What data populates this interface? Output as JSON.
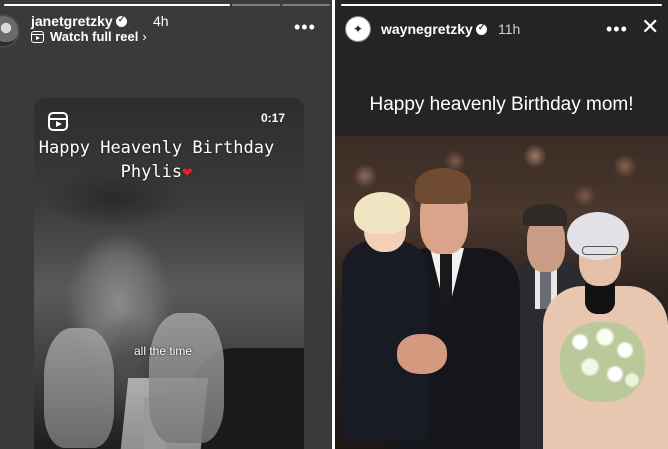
{
  "left_story": {
    "username": "janetgretzky",
    "time": "4h",
    "watch_label": "Watch full reel",
    "more_label": "•••",
    "reel": {
      "duration": "0:17",
      "overlay_line1": "Happy Heavenly Birthday",
      "overlay_line2": "Phylis",
      "heart": "❤",
      "caption": "all the time"
    },
    "progress": [
      1.0,
      0.0,
      0.0
    ]
  },
  "right_story": {
    "username": "waynegretzky",
    "time": "11h",
    "more_label": "•••",
    "close_label": "✕",
    "caption": "Happy heavenly Birthday mom!"
  },
  "colors": {
    "left_background": "#3a3a3c",
    "right_background": "#242424",
    "heart": "#e0242f"
  },
  "icons": [
    "verified-badge-icon",
    "reel-icon",
    "chevron-right-icon",
    "more-options-icon",
    "close-icon"
  ]
}
